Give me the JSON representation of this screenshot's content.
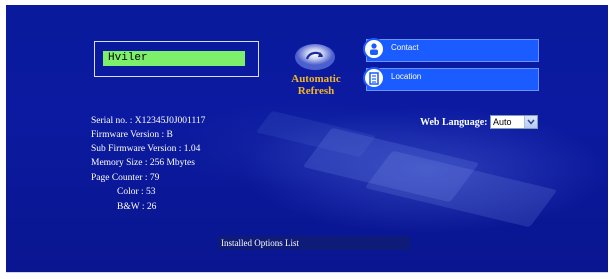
{
  "status": {
    "display_text": "Hviler"
  },
  "refresh": {
    "label_line1": "Automatic",
    "label_line2": "Refresh",
    "icon": "refresh-icon"
  },
  "nav": {
    "contact_label": "Contact",
    "location_label": "Location",
    "contact_icon": "person-icon",
    "location_icon": "building-icon"
  },
  "device_info": {
    "serial": "Serial no. : X12345J0J001117",
    "firmware": "Firmware Version : B",
    "sub_firmware": "Sub Firmware Version : 1.04",
    "memory": "Memory Size : 256 Mbytes",
    "page_counter": "Page Counter : 79",
    "color": "Color : 53",
    "bw": "B&W : 26"
  },
  "language": {
    "label": "Web Language:",
    "selected": "Auto"
  },
  "installed_options": {
    "label": "Installed Options List"
  },
  "colors": {
    "background": "#0b1aa0",
    "accent": "#1a5cff",
    "status_display": "#7cf06a",
    "refresh_label": "#f2b52a"
  }
}
